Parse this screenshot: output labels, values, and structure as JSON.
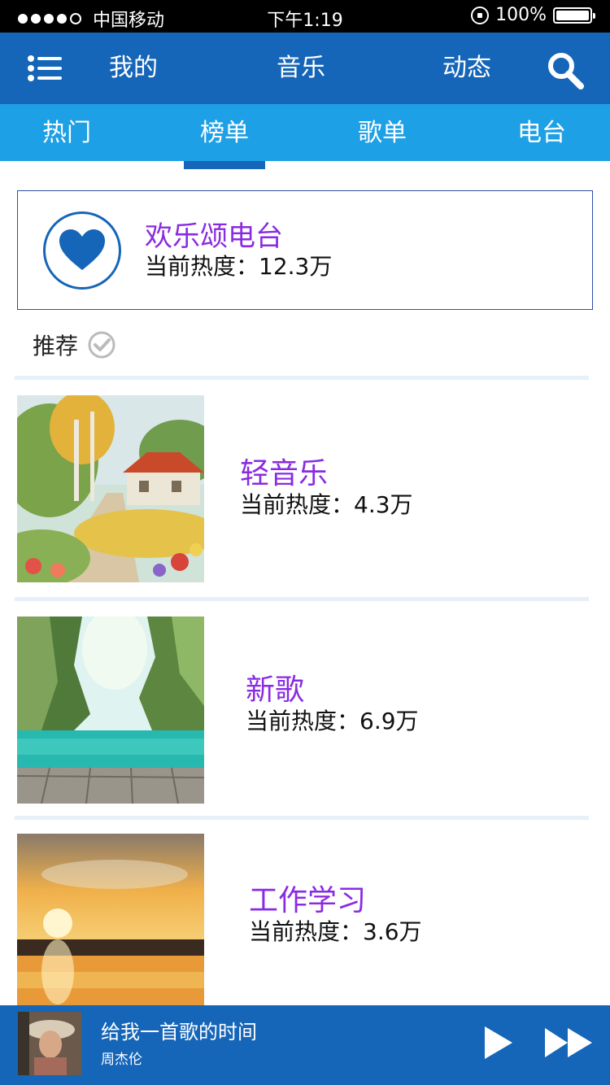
{
  "status_bar": {
    "carrier": "中国移动",
    "time": "下午1:19",
    "battery": "100%",
    "signal_dots_filled": 4,
    "signal_dots_total": 5
  },
  "top_nav": {
    "items": [
      "我的",
      "音乐",
      "动态"
    ],
    "menu_icon": "menu-icon",
    "search_icon": "search-icon"
  },
  "sub_tabs": {
    "items": [
      "热门",
      "榜单",
      "歌单",
      "电台"
    ],
    "active": "榜单"
  },
  "featured": {
    "icon": "heart-icon",
    "title": "欢乐颂电台",
    "heat": "当前热度：12.3万"
  },
  "recommend": {
    "label": "推荐",
    "icon": "check-circle-icon"
  },
  "list": [
    {
      "title": "轻音乐",
      "heat": "当前热度：4.3万",
      "image": "cottage-painting"
    },
    {
      "title": "新歌",
      "heat": "当前热度：6.9万",
      "image": "lagoon-cliffs"
    },
    {
      "title": "工作学习",
      "heat": "当前热度：3.6万",
      "image": "sunset-lake"
    }
  ],
  "player": {
    "song": "给我一首歌的时间",
    "artist": "周杰伦",
    "play_icon": "play-icon",
    "next_icon": "fast-forward-icon"
  },
  "colors": {
    "primary_blue": "#1565b8",
    "tab_blue": "#1ea0e6",
    "title_purple": "#8a2be2"
  }
}
